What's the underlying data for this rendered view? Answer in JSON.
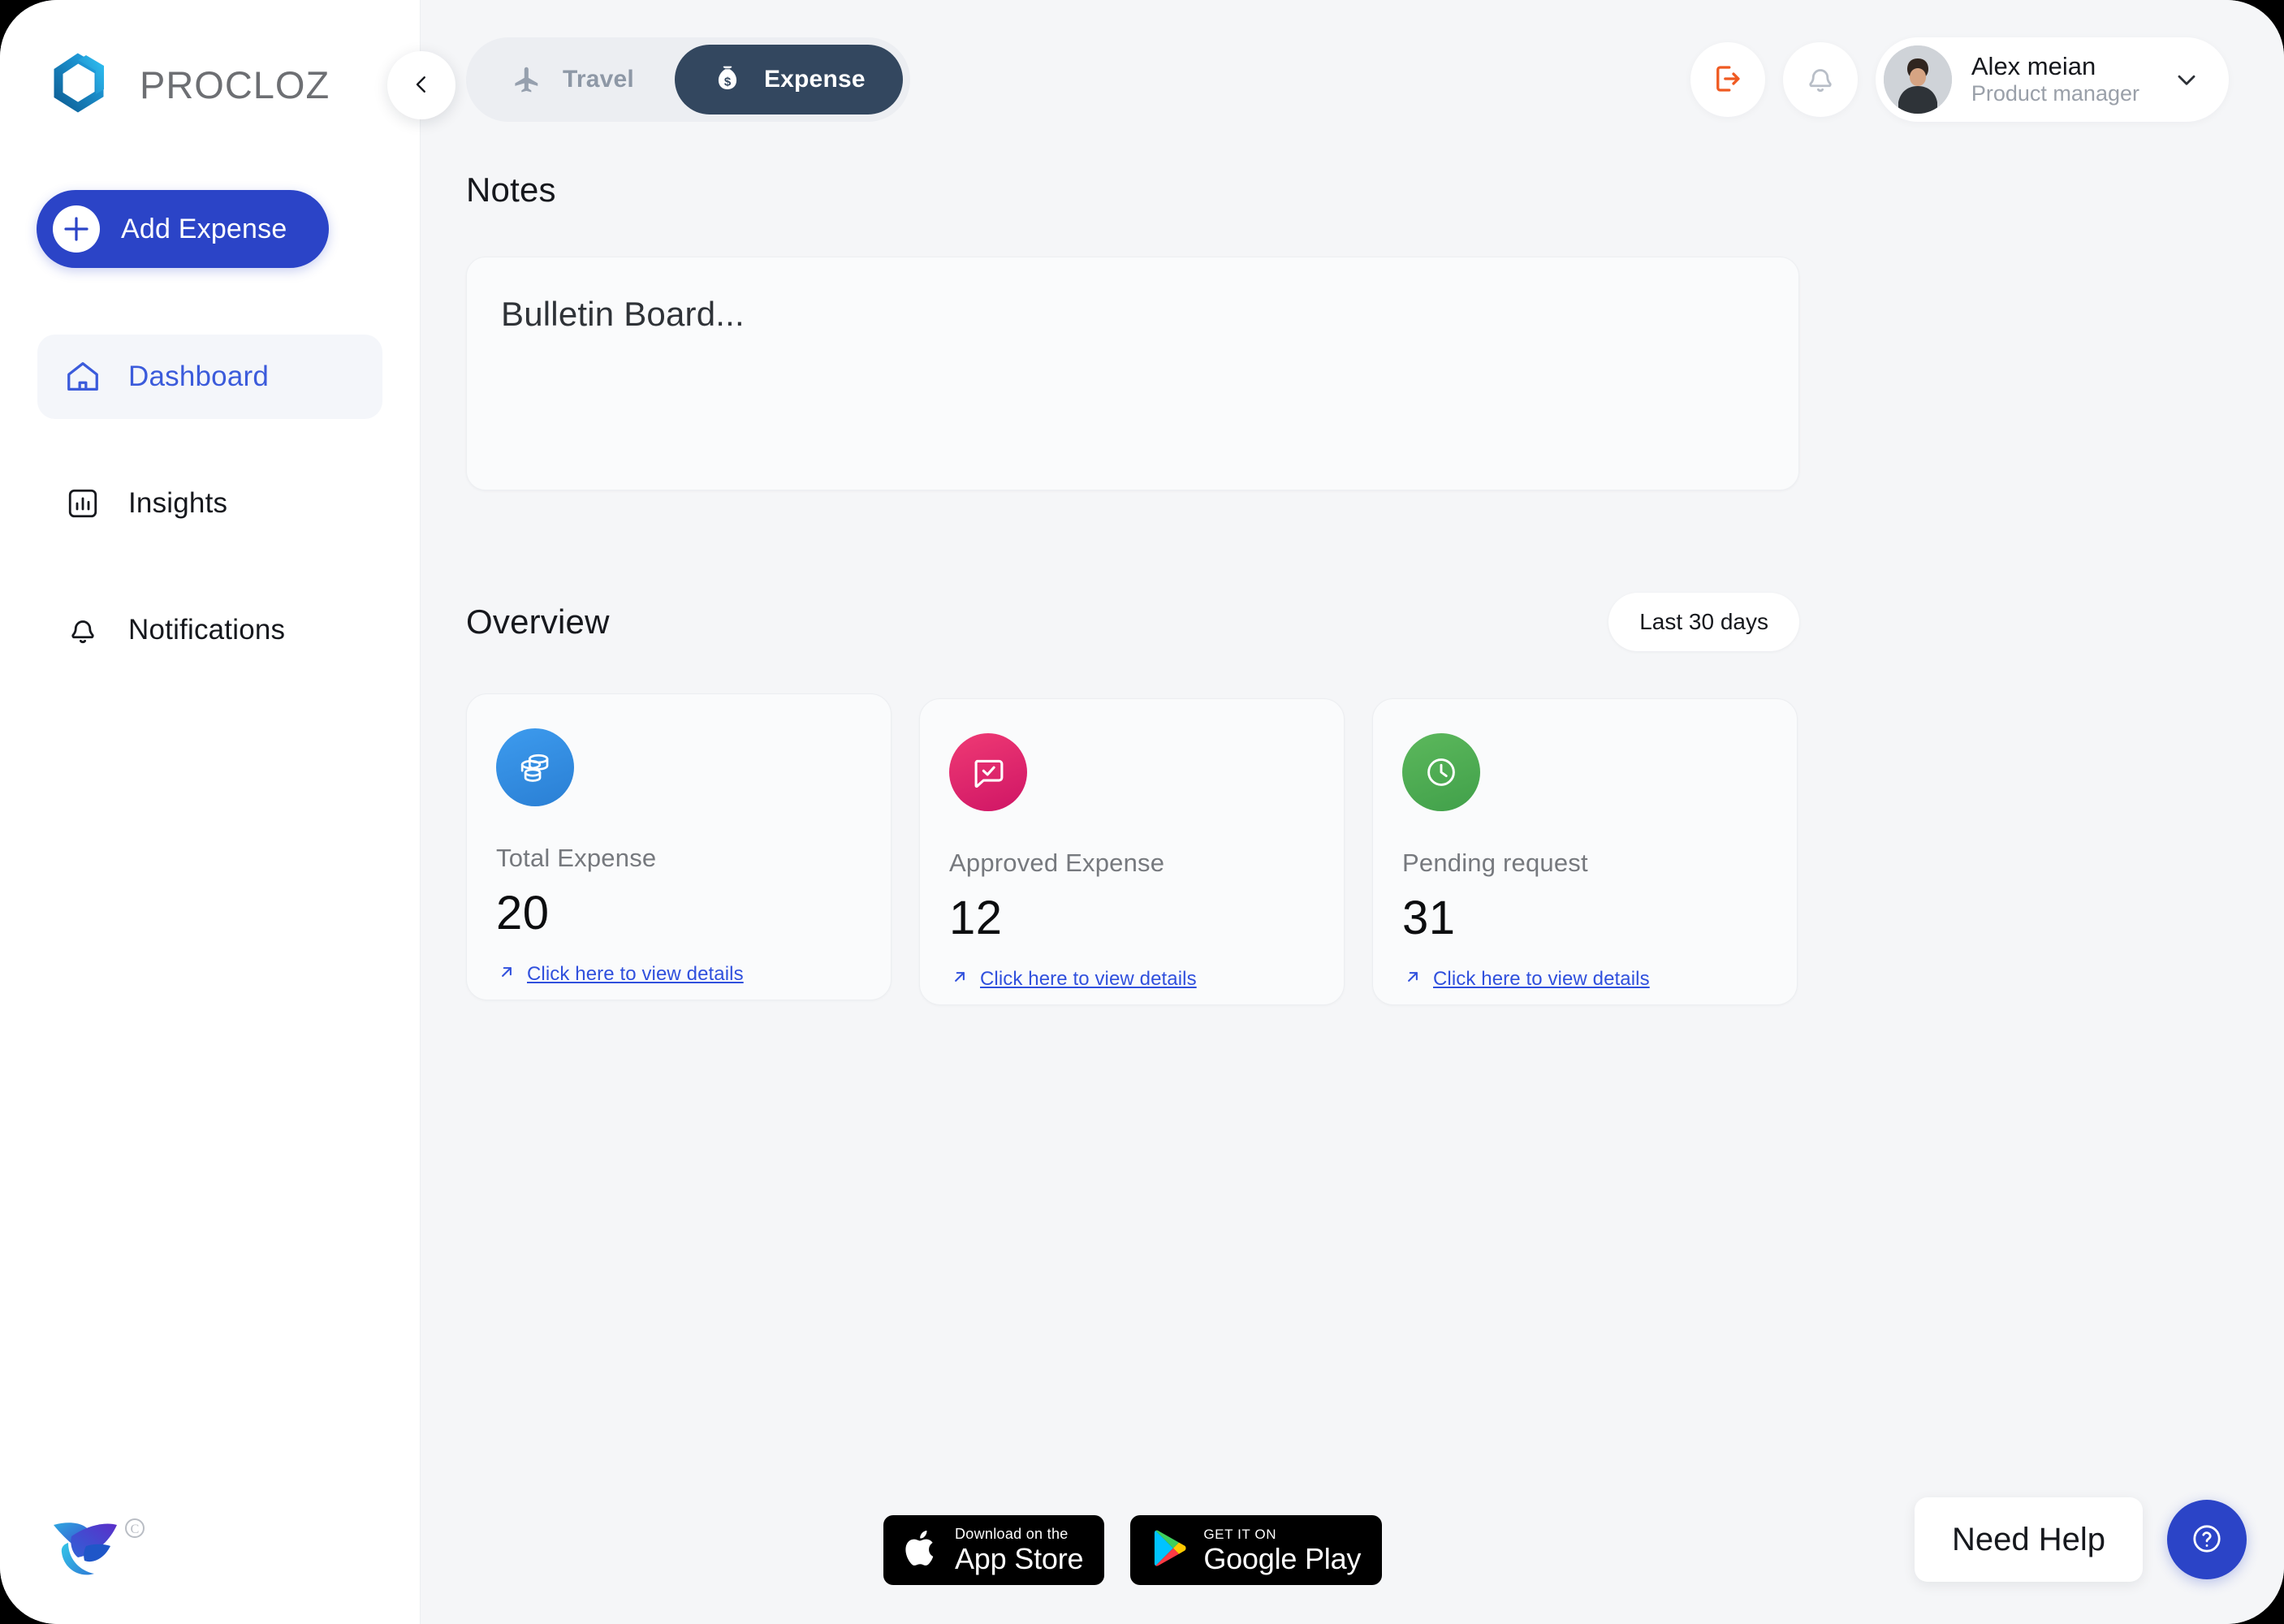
{
  "brand": {
    "name": "PROCLOZ",
    "logo_icon": "procloz-hexagon-logo",
    "footer_logo_icon": "hummingbird-logo",
    "footer_copyright_mark": "©"
  },
  "sidebar": {
    "add_expense_label": "Add Expense",
    "add_icon": "plus-icon",
    "collapse_icon": "chevron-left-icon",
    "items": [
      {
        "label": "Dashboard",
        "icon": "home-icon",
        "active": true
      },
      {
        "label": "Insights",
        "icon": "bar-chart-icon",
        "active": false
      },
      {
        "label": "Notifications",
        "icon": "bell-icon",
        "active": false
      }
    ]
  },
  "topbar": {
    "tabs": [
      {
        "label": "Travel",
        "icon": "airplane-icon",
        "active": false
      },
      {
        "label": "Expense",
        "icon": "money-bag-icon",
        "active": true
      }
    ],
    "logout_icon": "logout-icon",
    "notification_icon": "bell-icon",
    "user": {
      "name": "Alex meian",
      "role": "Product manager",
      "avatar_icon": "user-avatar",
      "chevron_icon": "chevron-down-icon"
    }
  },
  "notes": {
    "title": "Notes",
    "placeholder": "Bulletin Board..."
  },
  "overview": {
    "title": "Overview",
    "range_label": "Last 30 days",
    "cards": [
      {
        "label": "Total Expense",
        "value": "20",
        "link_text": "Click here to view details",
        "link_icon": "arrow-up-right-icon",
        "icon": "database-stack-icon",
        "color": "#3d9bee"
      },
      {
        "label": "Approved Expense",
        "value": "12",
        "link_text": "Click here to view details",
        "link_icon": "arrow-up-right-icon",
        "icon": "chat-check-icon",
        "color": "#ef3a74"
      },
      {
        "label": "Pending request",
        "value": "31",
        "link_text": "Click here to view details",
        "link_icon": "arrow-up-right-icon",
        "icon": "clock-icon",
        "color": "#5cb85c"
      }
    ]
  },
  "store_badges": [
    {
      "small": "Download on the",
      "big": "App Store",
      "icon": "apple-icon"
    },
    {
      "small": "GET IT ON",
      "big": "Google Play",
      "icon": "google-play-icon"
    }
  ],
  "help": {
    "label": "Need Help",
    "icon": "question-mark-icon"
  },
  "colors": {
    "accent_blue": "#2b44c7",
    "link_blue": "#3050dd",
    "active_nav": "#3b5bdb",
    "tab_active_bg": "#33475f",
    "logout_orange": "#ef5a22",
    "page_bg": "#f5f6f8",
    "sidebar_bg": "#ffffff"
  }
}
